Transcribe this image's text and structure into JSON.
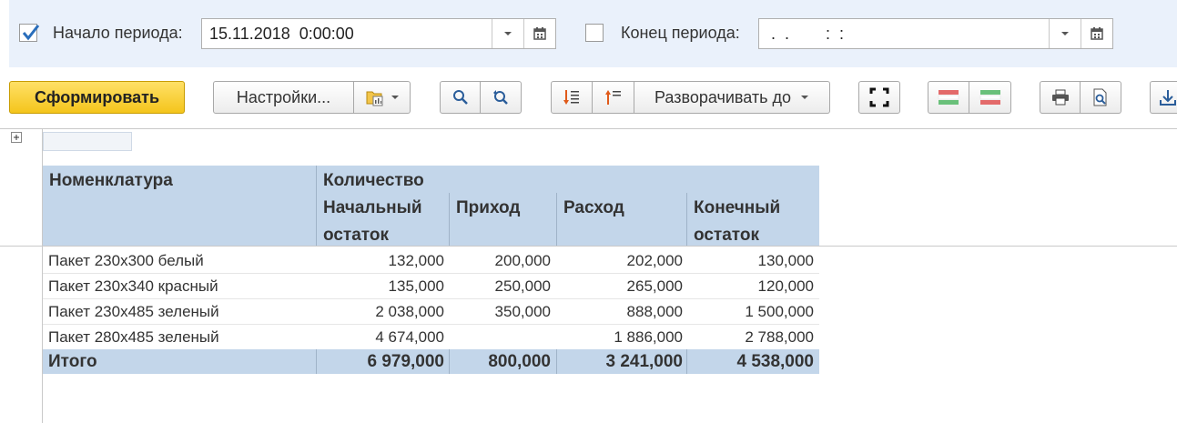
{
  "period": {
    "start": {
      "checked": true,
      "label": "Начало периода:",
      "value": "15.11.2018  0:00:00"
    },
    "end": {
      "checked": false,
      "label": "Конец периода:",
      "value": " .  .        :  :"
    }
  },
  "toolbar": {
    "generate_label": "Сформировать",
    "settings_label": "Настройки...",
    "expand_to_label": "Разворачивать до"
  },
  "report": {
    "headers": {
      "item": "Номенклатура",
      "quantity": "Количество",
      "opening_line1": "Начальный",
      "opening_line2": "остаток",
      "receipt": "Приход",
      "expense": "Расход",
      "closing_line1": "Конечный",
      "closing_line2": "остаток"
    },
    "rows": [
      {
        "item": "Пакет 230х300 белый",
        "opening": "132,000",
        "receipt": "200,000",
        "expense": "202,000",
        "closing": "130,000"
      },
      {
        "item": "Пакет 230х340 красный",
        "opening": "135,000",
        "receipt": "250,000",
        "expense": "265,000",
        "closing": "120,000"
      },
      {
        "item": "Пакет 230х485 зеленый",
        "opening": "2 038,000",
        "receipt": "350,000",
        "expense": "888,000",
        "closing": "1 500,000"
      },
      {
        "item": "Пакет 280х485 зеленый",
        "opening": "4 674,000",
        "receipt": "",
        "expense": "1 886,000",
        "closing": "2 788,000"
      }
    ],
    "total": {
      "label": "Итого",
      "opening": "6 979,000",
      "receipt": "800,000",
      "expense": "3 241,000",
      "closing": "4 538,000"
    }
  }
}
